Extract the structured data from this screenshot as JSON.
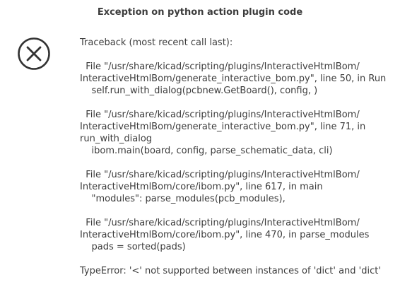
{
  "dialog": {
    "title": "Exception on python action plugin code",
    "icon": "error-circle-x-icon"
  },
  "message": {
    "lines": [
      "Traceback (most recent call last):",
      "",
      "  File \"/usr/share/kicad/scripting/plugins/InteractiveHtmlBom/",
      "InteractiveHtmlBom/generate_interactive_bom.py\", line 50, in Run",
      "    self.run_with_dialog(pcbnew.GetBoard(), config, )",
      "",
      "  File \"/usr/share/kicad/scripting/plugins/InteractiveHtmlBom/",
      "InteractiveHtmlBom/generate_interactive_bom.py\", line 71, in",
      "run_with_dialog",
      "    ibom.main(board, config, parse_schematic_data, cli)",
      "",
      "  File \"/usr/share/kicad/scripting/plugins/InteractiveHtmlBom/",
      "InteractiveHtmlBom/core/ibom.py\", line 617, in main",
      "    \"modules\": parse_modules(pcb_modules),",
      "",
      "  File \"/usr/share/kicad/scripting/plugins/InteractiveHtmlBom/",
      "InteractiveHtmlBom/core/ibom.py\", line 470, in parse_modules",
      "    pads = sorted(pads)",
      "",
      "TypeError: '<' not supported between instances of 'dict' and 'dict'"
    ]
  },
  "colors": {
    "text": "#3c3c3c",
    "icon": "#333333",
    "background": "#ffffff"
  }
}
